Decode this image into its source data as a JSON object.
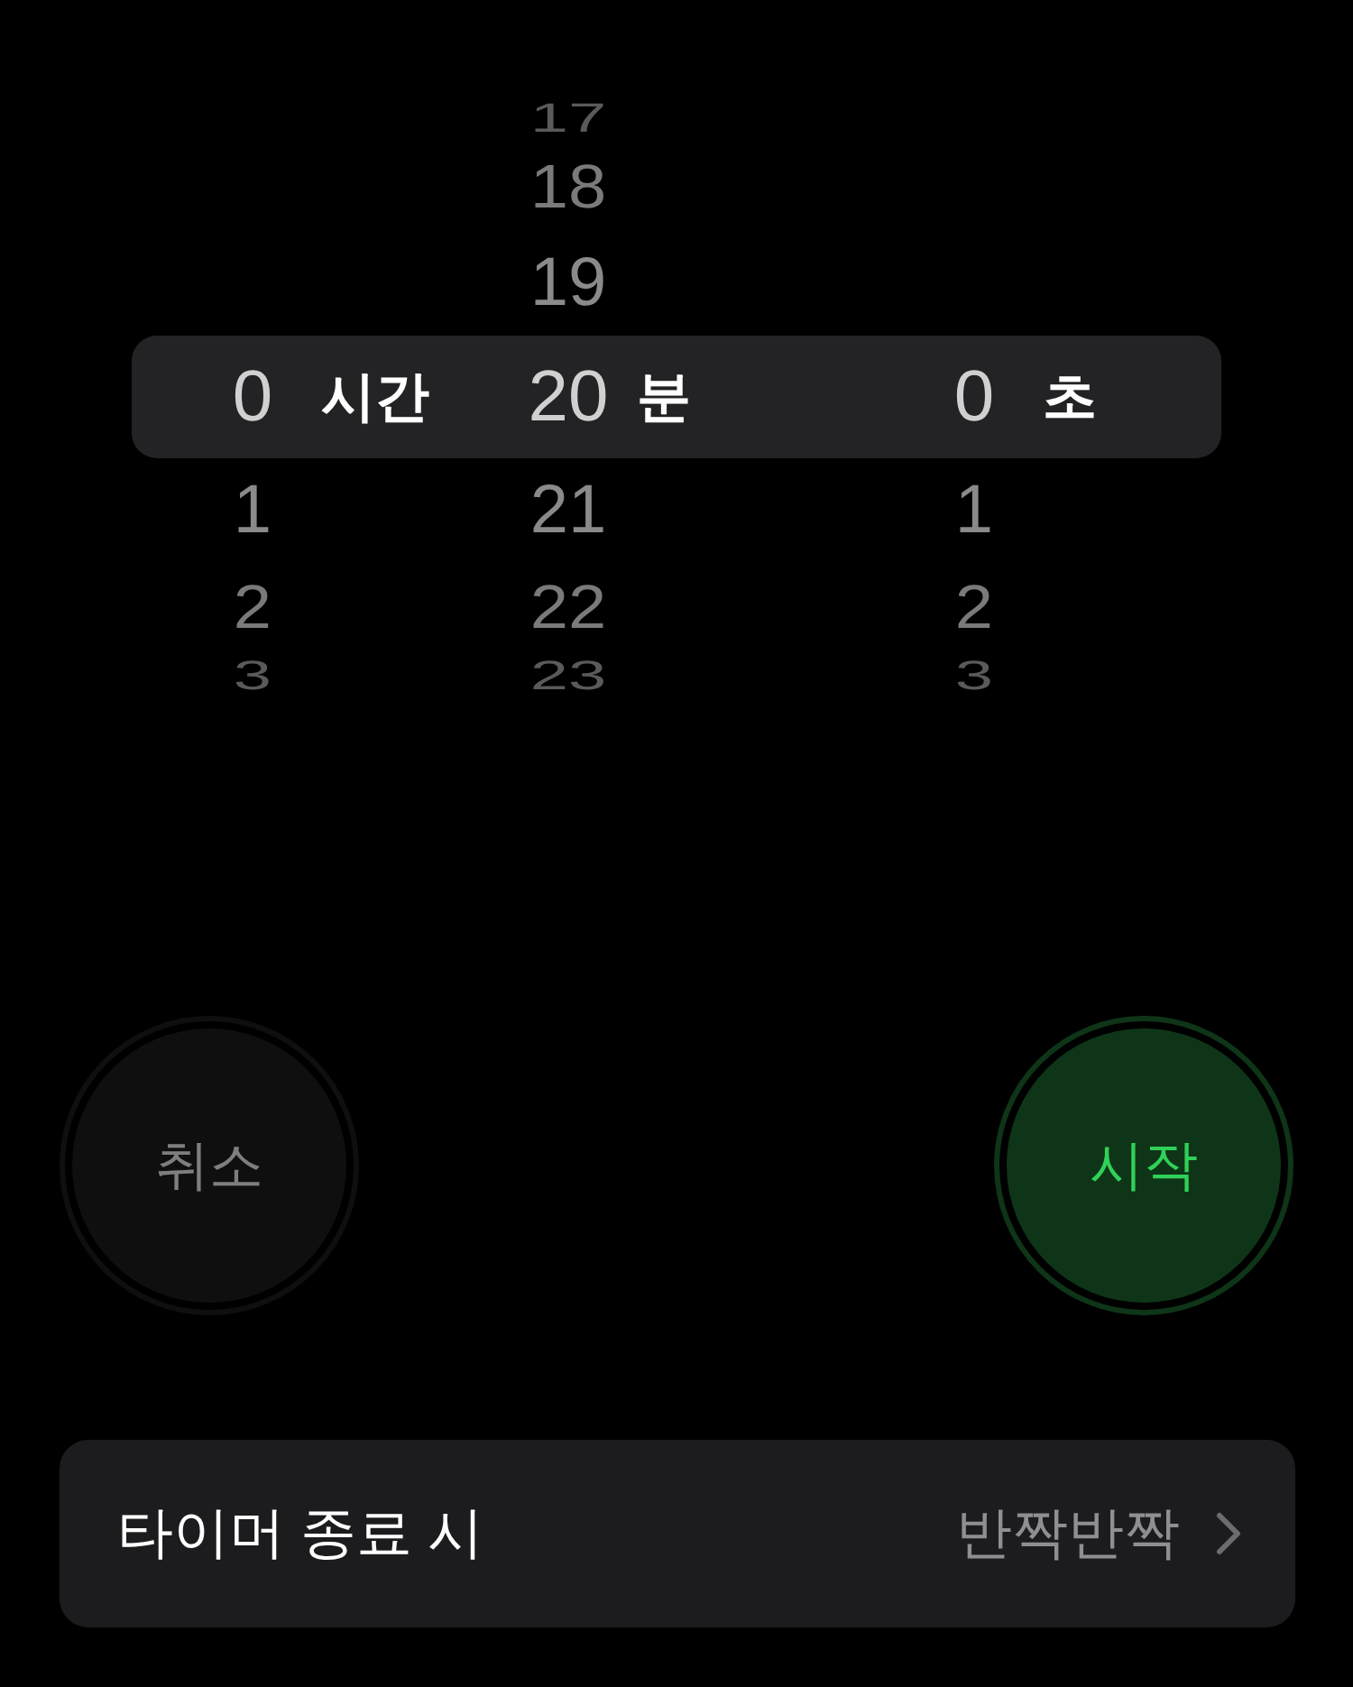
{
  "picker": {
    "columns": [
      {
        "unit": "시간",
        "rows": [
          {
            "label": "0",
            "selected": true
          },
          {
            "label": "1",
            "selected": false
          },
          {
            "label": "2",
            "selected": false
          },
          {
            "label": "3",
            "selected": false
          }
        ]
      },
      {
        "unit": "분",
        "rows": [
          {
            "label": "17",
            "selected": false
          },
          {
            "label": "18",
            "selected": false
          },
          {
            "label": "19",
            "selected": false
          },
          {
            "label": "20",
            "selected": true
          },
          {
            "label": "21",
            "selected": false
          },
          {
            "label": "22",
            "selected": false
          },
          {
            "label": "23",
            "selected": false
          }
        ]
      },
      {
        "unit": "초",
        "rows": [
          {
            "label": "0",
            "selected": true
          },
          {
            "label": "1",
            "selected": false
          },
          {
            "label": "2",
            "selected": false
          },
          {
            "label": "3",
            "selected": false
          }
        ]
      }
    ]
  },
  "buttons": [
    {
      "kind": "cancel",
      "label": "취소",
      "disabled": true
    },
    {
      "kind": "start",
      "label": "시작",
      "disabled": false
    }
  ],
  "when_timer_ends": {
    "label": "타이머 종료 시",
    "value": "반짝반짝"
  }
}
